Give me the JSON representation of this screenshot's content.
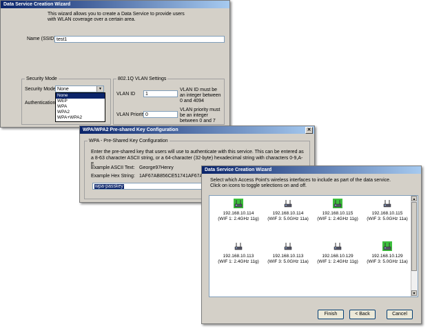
{
  "win1": {
    "title": "Data Service Creation Wizard",
    "intro": "This wizard allows you to create a Data Service to provide users with WLAN coverage over a certain area.",
    "ssid_label": "Name (SSID)",
    "ssid_value": "test1",
    "security_group": "Security Mode",
    "security_label": "Security Mode",
    "security_value": "None",
    "security_options": [
      "None",
      "WEP",
      "WPA",
      "WPA2",
      "WPA+WPA2"
    ],
    "auth_label": "Authentication",
    "vlan_group": "802.1Q VLAN Settings",
    "vlan_id_label": "VLAN ID",
    "vlan_id_value": "1",
    "vlan_id_hint": "VLAN ID must be an integer between 0 and 4094",
    "vlan_prio_label": "VLAN Priority",
    "vlan_prio_value": "0",
    "vlan_prio_hint": "VLAN priority must be an integer between 0 and 7"
  },
  "win2": {
    "title": "WPA/WPA2 Pre-shared Key Configuration",
    "group": "WPA - Pre-Shared Key Configuration",
    "desc": "Enter the pre-shared key that users will use to authenticate with this service. This can be entered as a 8-63 character ASCII string, or a 64-character (32-byte) hexadecimal string with characters 0-9,A-F.",
    "ascii_label": "Example ASCII Text:",
    "ascii_value": "George97Henry",
    "hex_label": "Example Hex String:",
    "hex_value": "1AF67AB856CE51741AF67AB856CE51",
    "key_value": "wpa-passkey"
  },
  "win3": {
    "title": "Data Service Creation Wizard",
    "desc": "Select which Access Point's wireless interfaces to include as part of the data service. Click on icons to toggle selections on and off.",
    "aps": [
      {
        "ip": "192.168.10.114",
        "iface": "(WIF 1: 2.4GHz 11g)",
        "selected": true
      },
      {
        "ip": "192.168.10.114",
        "iface": "(WIF 3: 5.0GHz 11a)",
        "selected": false
      },
      {
        "ip": "192.168.10.115",
        "iface": "(WIF 1: 2.4GHz 11g)",
        "selected": true
      },
      {
        "ip": "192.168.10.115",
        "iface": "(WIF 3: 5.0GHz 11a)",
        "selected": false
      },
      {
        "ip": "192.168.10.113",
        "iface": "(WIF 1: 2.4GHz 11g)",
        "selected": false
      },
      {
        "ip": "192.168.10.113",
        "iface": "(WIF 3: 5.0GHz 11a)",
        "selected": false
      },
      {
        "ip": "192.168.10.129",
        "iface": "(WIF 1: 2.4GHz 11g)",
        "selected": false
      },
      {
        "ip": "192.168.10.129",
        "iface": "(WIF 3: 5.0GHz 11a)",
        "selected": true
      }
    ],
    "finish_label": "Finish",
    "back_label": "< Back",
    "cancel_label": "Cancel"
  },
  "colors": {
    "titlebar": "#0a246a",
    "selected_ap": "#3cbf3c",
    "window_bg": "#d4d0c8"
  }
}
